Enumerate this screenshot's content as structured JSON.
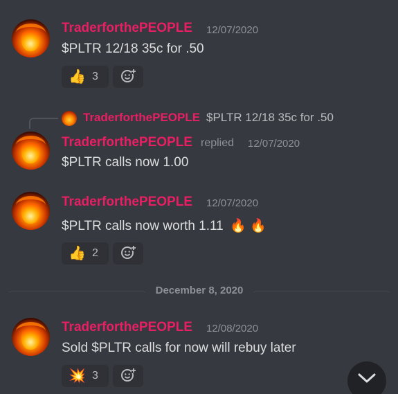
{
  "messages": [
    {
      "author": "TraderforthePEOPLE",
      "timestamp": "12/07/2020",
      "text": "$PLTR 12/18 35c for .50",
      "reaction": {
        "emoji": "👍",
        "count": "3"
      }
    },
    {
      "reply_to": {
        "author": "TraderforthePEOPLE",
        "text": "$PLTR 12/18 35c for .50"
      },
      "author": "TraderforthePEOPLE",
      "replied_label": "replied",
      "timestamp": "12/07/2020",
      "text": "$PLTR calls now 1.00"
    },
    {
      "author": "TraderforthePEOPLE",
      "timestamp": "12/07/2020",
      "text": "$PLTR calls now worth 1.11",
      "emojis": "🔥 🔥",
      "reaction": {
        "emoji": "👍",
        "count": "2"
      }
    },
    {
      "author": "TraderforthePEOPLE",
      "timestamp": "12/08/2020",
      "text": "Sold $PLTR calls for now will rebuy later",
      "reaction": {
        "emoji": "💥",
        "count": "3"
      }
    }
  ],
  "date_divider": "December 8, 2020",
  "icons": {
    "add_reaction": "add-reaction-icon",
    "scroll_down": "chevron-down-icon"
  },
  "colors": {
    "background": "#36393f",
    "author": "#e91e63",
    "timestamp": "#8e9297"
  }
}
